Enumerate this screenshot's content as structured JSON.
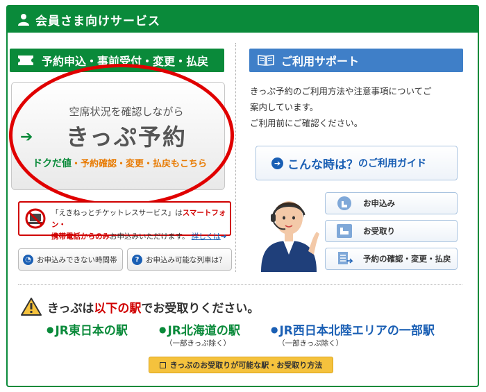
{
  "header": {
    "title": "会員さま向けサービス",
    "icon": "person-icon"
  },
  "reservation": {
    "section_title": "予約申込・事前受付・変更・払戻",
    "big_button": {
      "sub": "空席状況を確認しながら",
      "main": "きっぷ予約",
      "foot_green": "ドクだ値",
      "foot_orange": "・予約確認・変更・払戻もこちら"
    },
    "warning": {
      "line1_prefix": "「えきねっとチケットレスサービス」は",
      "line1_red": "スマートフォン・",
      "line2_red": "携帯電話からのみ",
      "line2_suffix": "お申込みいただけます。",
      "link": "詳しくは"
    },
    "small_buttons": [
      {
        "label": "お申込みできない時間帯",
        "icon": "clock-icon"
      },
      {
        "label": "お申込み可能な列車は？",
        "icon": "question-icon"
      }
    ]
  },
  "support": {
    "title": "ご利用サポート",
    "text_lines": [
      "きっぷ予約のご利用方法や注意事項についてご",
      "案内しています。",
      "ご利用前にご確認ください。"
    ],
    "guide_button": {
      "t1": "こんな時は？",
      "t2": "のご利用ガイド"
    },
    "side_buttons": [
      {
        "label": "お申込み",
        "icon": "hand-pointer-icon"
      },
      {
        "label": "お受取り",
        "icon": "hand-receive-icon"
      },
      {
        "label": "予約の確認・変更・払戻",
        "icon": "document-icon"
      }
    ]
  },
  "receive": {
    "msg_prefix": "きっぷは",
    "msg_red": "以下の駅",
    "msg_suffix": "でお受取りください。",
    "stations": [
      {
        "name": "JR東日本の駅",
        "note": ""
      },
      {
        "name": "JR北海道の駅",
        "note": "（一部きっぷ除く）"
      },
      {
        "name": "JR西日本北陸エリアの一部駅",
        "note": "（一部きっぷ除く）"
      }
    ],
    "button_label": "きっぷのお受取りが可能な駅・お受取り方法"
  },
  "colors": {
    "green": "#0a8a3a",
    "blue": "#3f7fc8",
    "link_blue": "#1a5fb4",
    "red": "#d00000",
    "orange": "#e87a00",
    "yellow": "#f5c23d"
  }
}
